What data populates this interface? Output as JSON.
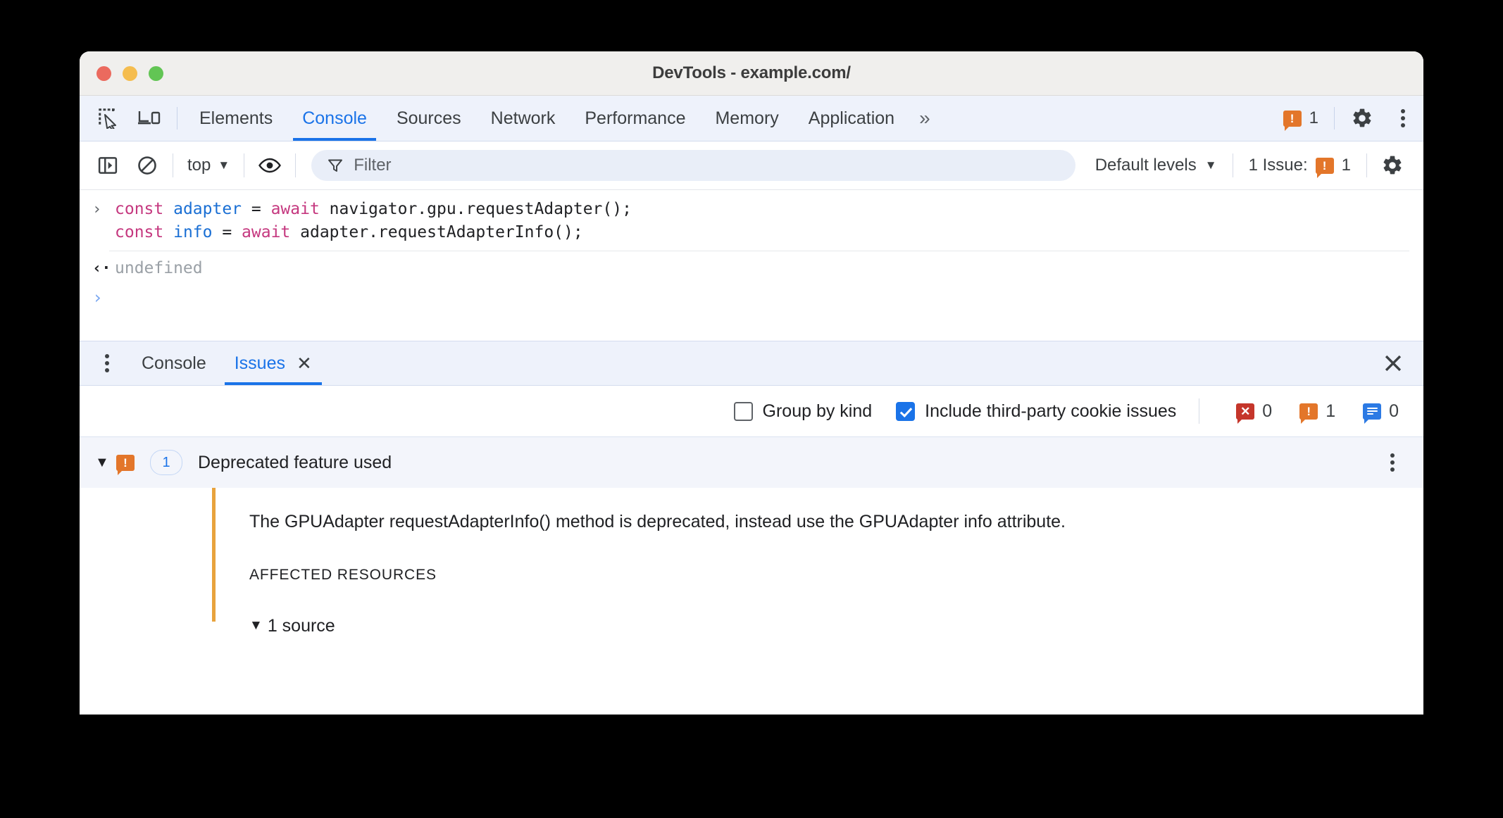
{
  "window": {
    "title": "DevTools - example.com/",
    "traffic_lights": [
      "close",
      "minimize",
      "maximize"
    ]
  },
  "main_toolbar": {
    "inspect_icon": "inspect-cursor-icon",
    "device_icon": "device-toolbar-icon",
    "tabs": [
      {
        "label": "Elements",
        "active": false
      },
      {
        "label": "Console",
        "active": true
      },
      {
        "label": "Sources",
        "active": false
      },
      {
        "label": "Network",
        "active": false
      },
      {
        "label": "Performance",
        "active": false
      },
      {
        "label": "Memory",
        "active": false
      },
      {
        "label": "Application",
        "active": false
      }
    ],
    "overflow_label": "»",
    "warning_count": "1",
    "settings_icon": "gear-icon",
    "more_icon": "kebab-menu-icon"
  },
  "console_toolbar": {
    "sidebar_toggle_icon": "show-console-sidebar-icon",
    "clear_icon": "clear-console-icon",
    "context": "top",
    "context_caret": "▼",
    "eye_icon": "live-expression-icon",
    "filter_icon": "funnel-icon",
    "filter_placeholder": "Filter",
    "filter_value": "",
    "levels_label": "Default levels",
    "levels_caret": "▼",
    "issues_label": "1 Issue:",
    "issues_count": "1",
    "settings_icon": "gear-icon"
  },
  "console_output": {
    "input_prompt": "›",
    "input_line1": [
      {
        "text": "const ",
        "type": "keyword"
      },
      {
        "text": "adapter ",
        "type": "identifier"
      },
      {
        "text": "= ",
        "type": "plain"
      },
      {
        "text": "await ",
        "type": "keyword"
      },
      {
        "text": "navigator.gpu.requestAdapter();",
        "type": "plain"
      }
    ],
    "input_line2": [
      {
        "text": "const ",
        "type": "keyword"
      },
      {
        "text": "info ",
        "type": "identifier"
      },
      {
        "text": "= ",
        "type": "plain"
      },
      {
        "text": "await ",
        "type": "keyword"
      },
      {
        "text": "adapter.requestAdapterInfo();",
        "type": "plain"
      }
    ],
    "result_arrow": "‹·",
    "result_value": "undefined",
    "next_prompt": "›"
  },
  "drawer": {
    "kebab_icon": "drawer-menu-icon",
    "tabs": [
      {
        "label": "Console",
        "active": false,
        "closable": false
      },
      {
        "label": "Issues",
        "active": true,
        "closable": true,
        "close_glyph": "✕"
      }
    ],
    "close_glyph": "✕"
  },
  "issues_bar": {
    "group_by_kind_label": "Group by kind",
    "group_by_kind_checked": false,
    "third_party_label": "Include third-party cookie issues",
    "third_party_checked": true,
    "counts": {
      "errors": "0",
      "warnings": "1",
      "info": "0"
    }
  },
  "issue": {
    "expand_glyph": "▼",
    "severity_icon": "warning-bubble-icon",
    "count_pill": "1",
    "title": "Deprecated feature used",
    "kebab_icon": "issue-menu-icon",
    "description": "The GPUAdapter requestAdapterInfo() method is deprecated, instead use the GPUAdapter info attribute.",
    "affected_resources_label": "AFFECTED RESOURCES",
    "source_glyph": "▼",
    "source_label": "1 source"
  },
  "colors": {
    "accent_blue": "#1a73e8",
    "warning_orange": "#e3762a",
    "error_red": "#c5362b",
    "info_blue": "#2c7ae4",
    "issue_border": "#e8a33d",
    "titlebar_bg": "#f0efed",
    "tabbar_bg": "#eef2fb"
  }
}
